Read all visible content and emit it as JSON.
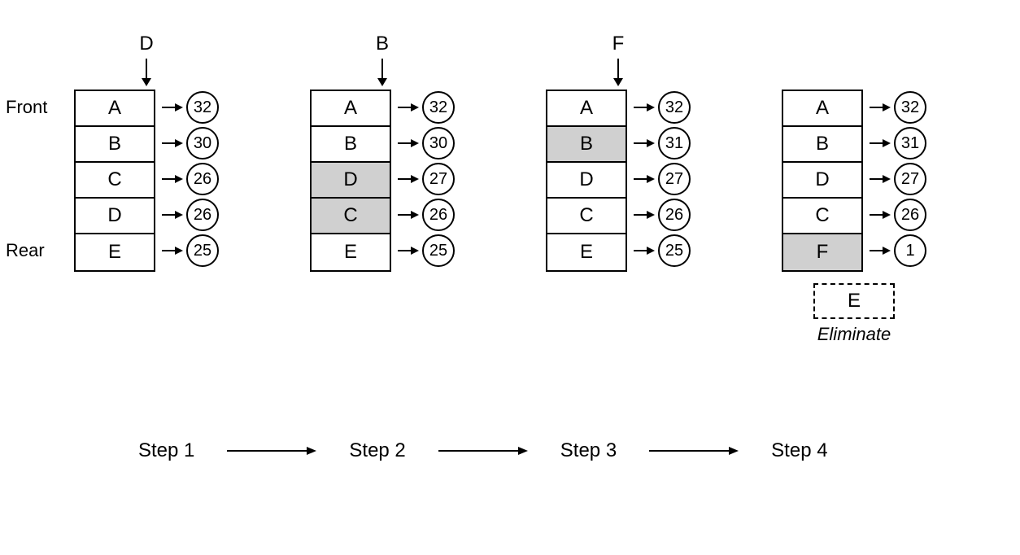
{
  "labels": {
    "front": "Front",
    "rear": "Rear",
    "eliminate": "Eliminate"
  },
  "columns": [
    {
      "insert": "D",
      "cells": [
        {
          "label": "A",
          "value": 32,
          "highlight": false
        },
        {
          "label": "B",
          "value": 30,
          "highlight": false
        },
        {
          "label": "C",
          "value": 26,
          "highlight": false
        },
        {
          "label": "D",
          "value": 26,
          "highlight": false
        },
        {
          "label": "E",
          "value": 25,
          "highlight": false
        }
      ],
      "eliminated": null
    },
    {
      "insert": "B",
      "cells": [
        {
          "label": "A",
          "value": 32,
          "highlight": false
        },
        {
          "label": "B",
          "value": 30,
          "highlight": false
        },
        {
          "label": "D",
          "value": 27,
          "highlight": true
        },
        {
          "label": "C",
          "value": 26,
          "highlight": true
        },
        {
          "label": "E",
          "value": 25,
          "highlight": false
        }
      ],
      "eliminated": null
    },
    {
      "insert": "F",
      "cells": [
        {
          "label": "A",
          "value": 32,
          "highlight": false
        },
        {
          "label": "B",
          "value": 31,
          "highlight": true
        },
        {
          "label": "D",
          "value": 27,
          "highlight": false
        },
        {
          "label": "C",
          "value": 26,
          "highlight": false
        },
        {
          "label": "E",
          "value": 25,
          "highlight": false
        }
      ],
      "eliminated": null
    },
    {
      "insert": "",
      "cells": [
        {
          "label": "A",
          "value": 32,
          "highlight": false
        },
        {
          "label": "B",
          "value": 31,
          "highlight": false
        },
        {
          "label": "D",
          "value": 27,
          "highlight": false
        },
        {
          "label": "C",
          "value": 26,
          "highlight": false
        },
        {
          "label": "F",
          "value": 1,
          "highlight": true
        }
      ],
      "eliminated": "E"
    }
  ],
  "steps": [
    "Step 1",
    "Step 2",
    "Step 3",
    "Step 4"
  ]
}
